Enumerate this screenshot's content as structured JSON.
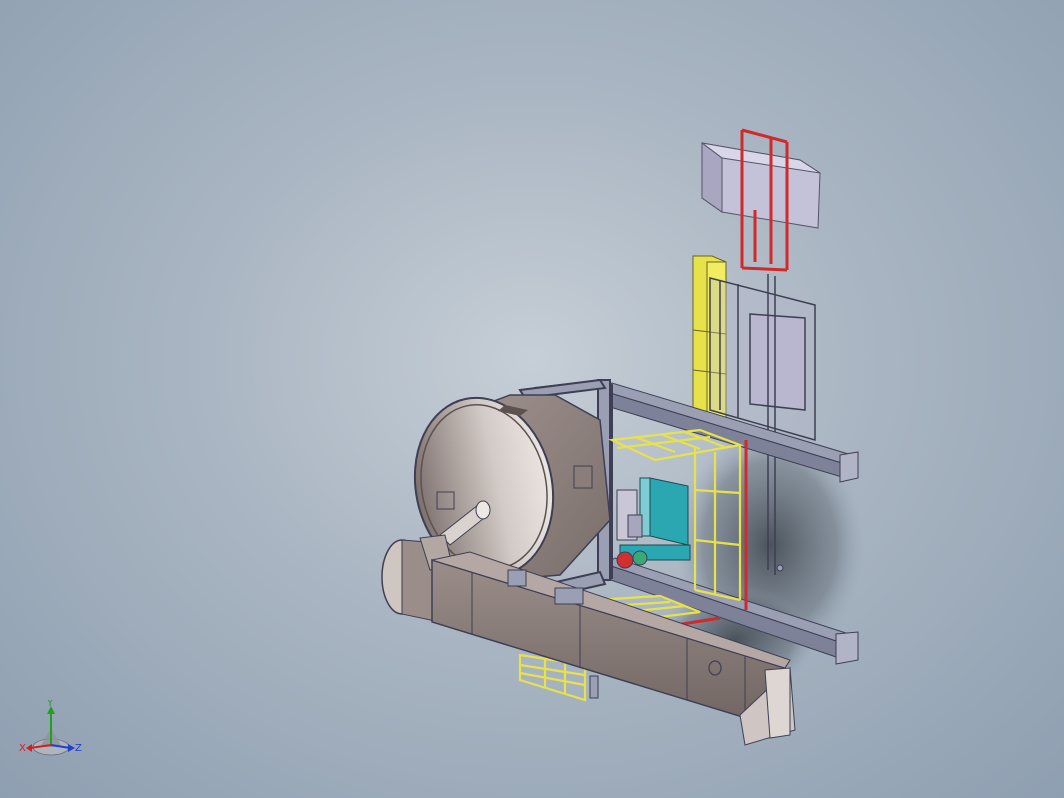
{
  "viewport": {
    "background_top": "#8e9fb1",
    "background_center": "#c6ced6"
  },
  "triad": {
    "x_label": "X",
    "y_label": "Y",
    "z_label": "Z",
    "x_color": "#d42020",
    "y_color": "#20a020",
    "z_color": "#2040d0"
  },
  "model": {
    "colors": {
      "steel": "#9a9fb4",
      "steel_dark": "#6c6f86",
      "drum": "#8c7f7c",
      "drum_inner": "#c9c0bd",
      "ladder": "#e8e24a",
      "rail_red": "#d02a2a",
      "panel_cyan": "#2aa7b0",
      "light_box": "#c4c2d8",
      "shadow": "#4a5058"
    }
  }
}
